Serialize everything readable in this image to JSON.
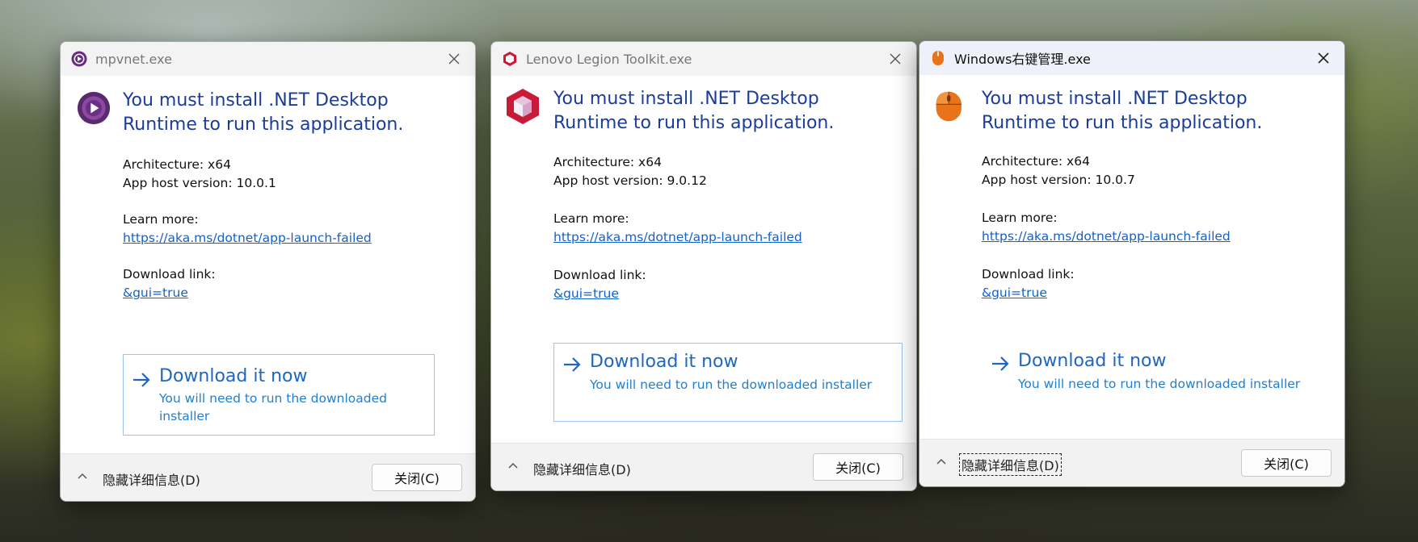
{
  "dialogs": [
    {
      "title": "mpvnet.exe",
      "heading_line1": "You must install .NET Desktop",
      "heading_line2": "Runtime to run this application.",
      "architecture": "Architecture: x64",
      "host_version": "App host version: 10.0.1",
      "learn_more_label": "Learn more:",
      "learn_more_link": "https://aka.ms/dotnet/app-launch-failed",
      "download_link_label": "Download link:",
      "download_link": "&gui=true",
      "download_now": "Download it now",
      "download_sub": "You will need to run the downloaded installer",
      "details_label": "隐藏详细信息(D)",
      "close_label": "关闭(C)",
      "icon": "mpv-icon"
    },
    {
      "title": "Lenovo Legion Toolkit.exe",
      "heading_line1": "You must install .NET Desktop",
      "heading_line2": "Runtime to run this application.",
      "architecture": "Architecture: x64",
      "host_version": "App host version: 9.0.12",
      "learn_more_label": "Learn more:",
      "learn_more_link": "https://aka.ms/dotnet/app-launch-failed",
      "download_link_label": "Download link:",
      "download_link": "&gui=true",
      "download_now": "Download it now",
      "download_sub": "You will need to run the downloaded installer",
      "details_label": "隐藏详细信息(D)",
      "close_label": "关闭(C)",
      "icon": "legion-toolkit-icon"
    },
    {
      "title": "Windows右键管理.exe",
      "heading_line1": "You must install .NET Desktop",
      "heading_line2": "Runtime to run this application.",
      "architecture": "Architecture: x64",
      "host_version": "App host version: 10.0.7",
      "learn_more_label": "Learn more:",
      "learn_more_link": "https://aka.ms/dotnet/app-launch-failed",
      "download_link_label": "Download link:",
      "download_link": "&gui=true",
      "download_now": "Download it now",
      "download_sub": "You will need to run the downloaded installer",
      "details_label": "隐藏详细信息(D)",
      "close_label": "关闭(C)",
      "icon": "mouse-icon"
    }
  ],
  "colors": {
    "heading": "#1c3c9a",
    "link": "#1461c9",
    "download_accent": "#1f66c1"
  }
}
